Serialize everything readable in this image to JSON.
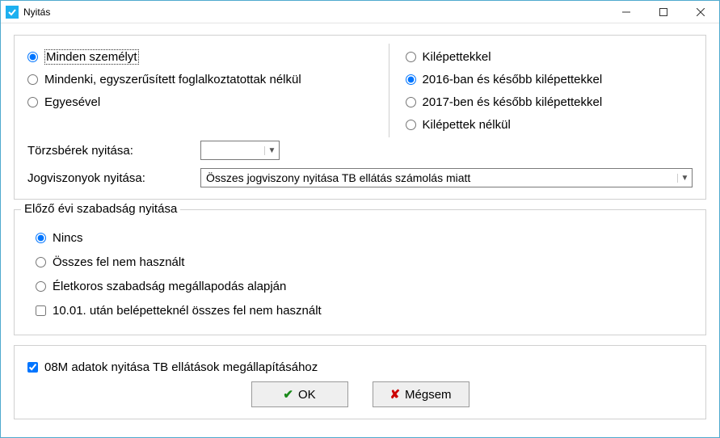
{
  "window": {
    "title": "Nyitás"
  },
  "left_radios": {
    "opt1": "Minden személyt",
    "opt2": "Mindenki, egyszerűsített foglalkoztatottak nélkül",
    "opt3": "Egyesével",
    "selected": 1
  },
  "right_radios": {
    "opt1": "Kilépettekkel",
    "opt2": "2016-ban és később kilépettekkel",
    "opt3": "2017-ben és később kilépettekkel",
    "opt4": "Kilépettek nélkül",
    "selected": 2
  },
  "base_wages": {
    "label": "Törzsbérek nyitása:",
    "value": ""
  },
  "jogviszony": {
    "label": "Jogviszonyok nyitása:",
    "value": "Összes jogviszony nyitása TB ellátás számolás miatt"
  },
  "prev_leave": {
    "title": "Előző évi szabadság nyitása",
    "opt1": "Nincs",
    "opt2": "Összes fel nem használt",
    "opt3": "Életkoros szabadság megállapodás alapján",
    "chk1": "10.01. után belépetteknél összes fel nem használt",
    "selected": 1
  },
  "bottom_check": {
    "label": "08M adatok nyitása TB ellátások megállapításához",
    "checked": true
  },
  "buttons": {
    "ok": "OK",
    "cancel": "Mégsem"
  }
}
